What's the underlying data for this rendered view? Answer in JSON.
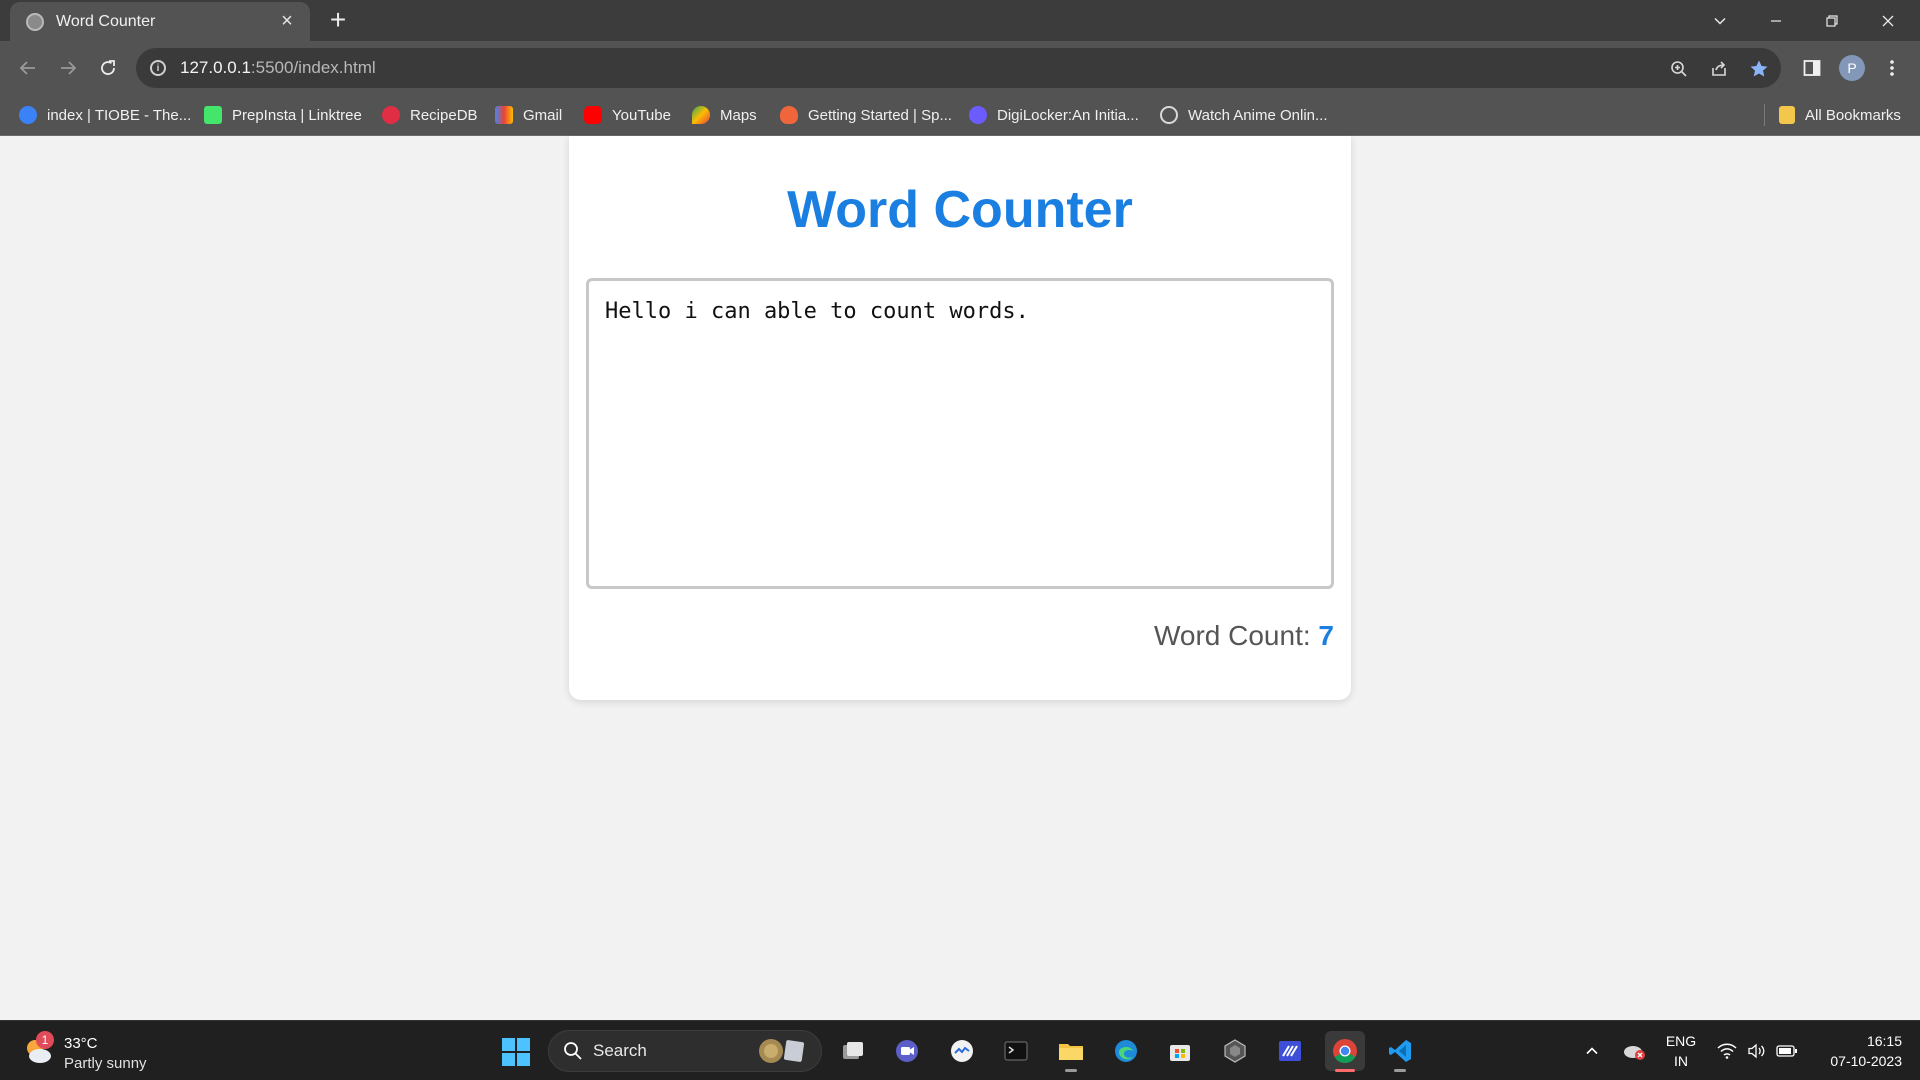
{
  "browser": {
    "tab_title": "Word Counter",
    "url_host": "127.0.0.1",
    "url_path": ":5500/index.html",
    "profile_initial": "P",
    "bookmarks": [
      {
        "label": "index | TIOBE - The...",
        "color": "#3b82f6"
      },
      {
        "label": "PrepInsta | Linktree",
        "color": "#43e66b"
      },
      {
        "label": "RecipeDB",
        "color": "#e02f45"
      },
      {
        "label": "Gmail",
        "color": "#ea4335"
      },
      {
        "label": "YouTube",
        "color": "#ff0000"
      },
      {
        "label": "Maps",
        "color": "#34a853"
      },
      {
        "label": "Getting Started | Sp...",
        "color": "#f0663a"
      },
      {
        "label": "DigiLocker:An Initia...",
        "color": "#6a5cff"
      },
      {
        "label": "Watch Anime Onlin...",
        "color": "#d9d9d9"
      }
    ],
    "all_bookmarks_label": "All Bookmarks"
  },
  "page": {
    "title": "Word Counter",
    "text_value": "Hello i can able to count words.",
    "count_label": "Word Count: ",
    "count_value": "7",
    "accent_color": "#1a7fe0"
  },
  "taskbar": {
    "weather_badge": "1",
    "weather_temp": "33°C",
    "weather_desc": "Partly sunny",
    "search_label": "Search",
    "lang_line1": "ENG",
    "lang_line2": "IN",
    "time": "16:15",
    "date": "07-10-2023"
  }
}
